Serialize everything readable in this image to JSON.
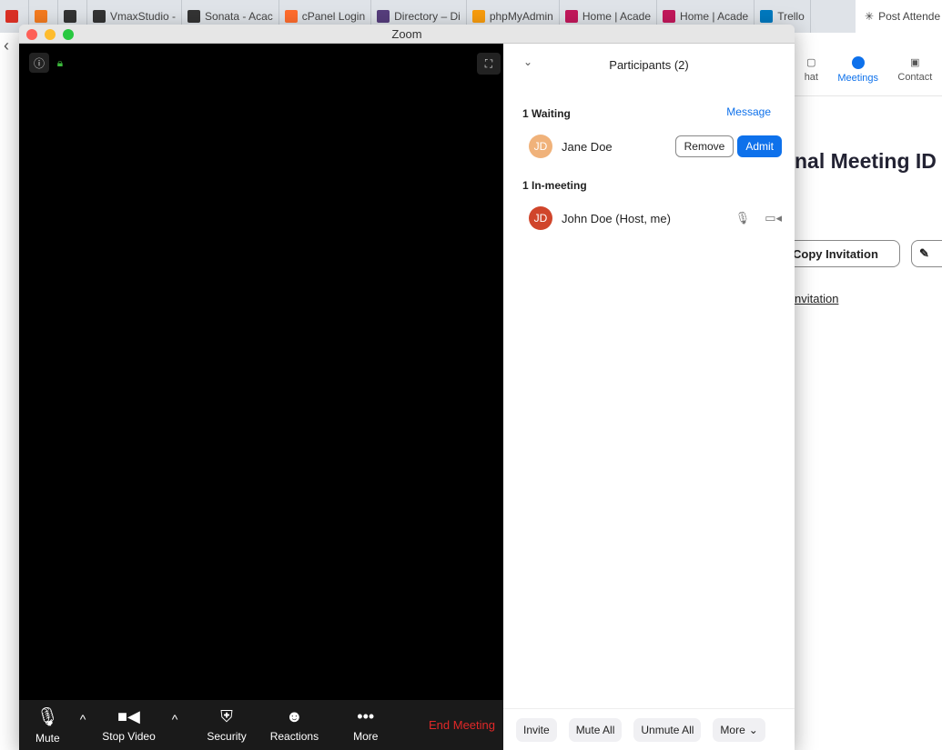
{
  "browser": {
    "tabs": [
      {
        "label": "",
        "color": "#d93025"
      },
      {
        "label": "",
        "color": "#f47b20"
      },
      {
        "label": "",
        "color": "#333333"
      },
      {
        "label": "VmaxStudio -",
        "color": "#333333"
      },
      {
        "label": "Sonata - Acac",
        "color": "#333333"
      },
      {
        "label": "cPanel Login",
        "color": "#ff6c2c"
      },
      {
        "label": "Directory – Di",
        "color": "#563d7c"
      },
      {
        "label": "phpMyAdmin",
        "color": "#f89c0e"
      },
      {
        "label": "Home | Acade",
        "color": "#c2185b"
      },
      {
        "label": "Home | Acade",
        "color": "#c2185b"
      },
      {
        "label": "Trello",
        "color": "#0079bf"
      }
    ],
    "active_tab": "Post Attende"
  },
  "background_app": {
    "tabs": [
      {
        "label": "hat"
      },
      {
        "label": "Meetings",
        "active": true
      },
      {
        "label": "Contact"
      }
    ],
    "title": "nal Meeting ID",
    "copy_invitation": "Copy Invitation",
    "link": "nvitation"
  },
  "window": {
    "title": "Zoom"
  },
  "toolbar": {
    "mute": "Mute",
    "stop_video": "Stop Video",
    "security": "Security",
    "reactions": "Reactions",
    "more": "More",
    "end_meeting": "End Meeting"
  },
  "participants": {
    "title": "Participants (2)",
    "waiting_label": "1 Waiting",
    "message": "Message",
    "waiting": [
      {
        "initials": "JD",
        "name": "Jane Doe",
        "avatar_color": "#f0b27a"
      }
    ],
    "remove": "Remove",
    "admit": "Admit",
    "in_meeting_label": "1 In-meeting",
    "in_meeting": [
      {
        "initials": "JD",
        "name": "John Doe (Host, me)",
        "avatar_color": "#d0452b"
      }
    ],
    "footer": {
      "invite": "Invite",
      "mute_all": "Mute All",
      "unmute_all": "Unmute All",
      "more": "More"
    }
  },
  "colors": {
    "accent": "#0e71eb",
    "end": "#e02828"
  }
}
